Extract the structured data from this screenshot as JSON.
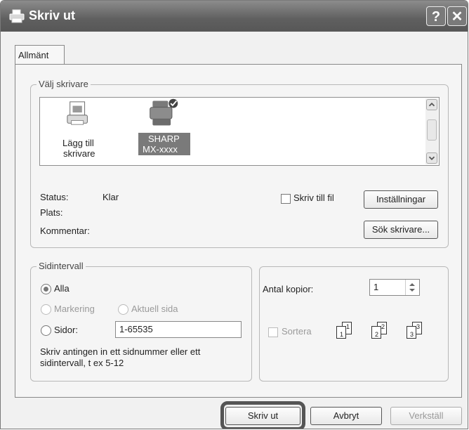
{
  "window": {
    "title": "Skriv ut",
    "help_label": "?",
    "close_label": "✕"
  },
  "tabs": [
    {
      "label": "Allmänt"
    }
  ],
  "select_printer": {
    "legend": "Välj skrivare",
    "items": [
      {
        "label_line1": "Lägg till",
        "label_line2": "skrivare",
        "icon": "add-printer-icon"
      },
      {
        "label_line1": "SHARP",
        "label_line2": "MX-xxxx",
        "icon": "printer-icon",
        "selected": true
      }
    ],
    "status_label": "Status:",
    "status_value": "Klar",
    "location_label": "Plats:",
    "comment_label": "Kommentar:",
    "print_to_file_label": "Skriv till fil",
    "preferences_button": "Inställningar",
    "find_printer_button": "Sök skrivare..."
  },
  "page_range": {
    "legend": "Sidintervall",
    "all_label": "Alla",
    "selection_label": "Markering",
    "current_page_label": "Aktuell sida",
    "pages_label": "Sidor:",
    "pages_value": "1-65535",
    "help_line1": "Skriv antingen in ett sidnummer eller ett",
    "help_line2": "sidintervall, t ex 5-12"
  },
  "copies": {
    "label": "Antal kopior:",
    "value": "1",
    "collate_label": "Sortera",
    "collate_pages": [
      {
        "front": "1",
        "back": "1"
      },
      {
        "front": "2",
        "back": "2"
      },
      {
        "front": "3",
        "back": "3"
      }
    ]
  },
  "footer": {
    "print_button": "Skriv ut",
    "cancel_button": "Avbryt",
    "apply_button": "Verkställ"
  },
  "colors": {
    "titlebar": "#6a6a6a",
    "selected_bg": "#7a7a7a",
    "highlight_ring": "#555555"
  }
}
